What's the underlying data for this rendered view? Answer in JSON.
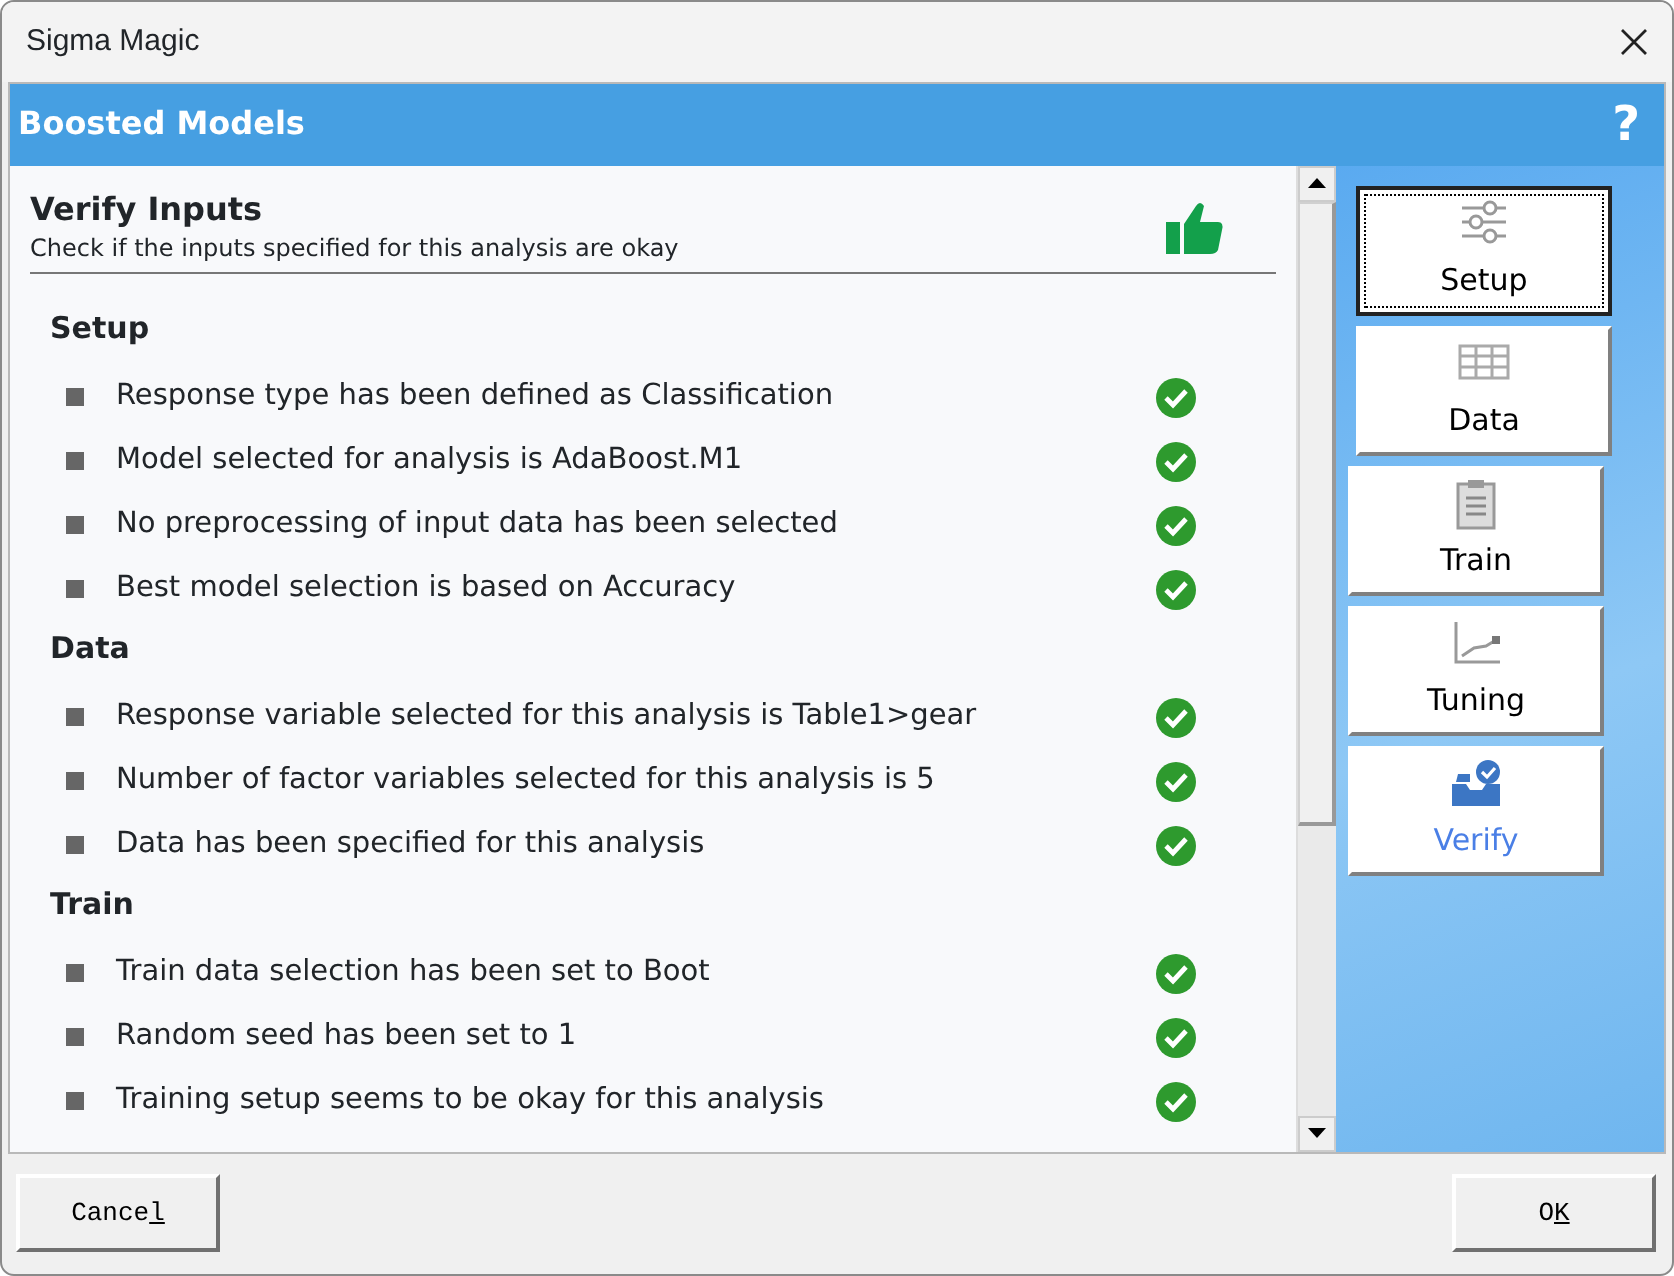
{
  "window": {
    "title": "Sigma Magic"
  },
  "header": {
    "title": "Boosted Models",
    "help": "?"
  },
  "panel": {
    "title": "Verify Inputs",
    "subtitle": "Check if the inputs specified for this analysis are okay"
  },
  "sections": [
    {
      "title": "Setup",
      "items": [
        {
          "text": "Response type has been defined as Classification",
          "ok": true
        },
        {
          "text": "Model selected for analysis is AdaBoost.M1",
          "ok": true
        },
        {
          "text": "No preprocessing of input data has been selected",
          "ok": true
        },
        {
          "text": "Best model selection is based on Accuracy",
          "ok": true
        }
      ]
    },
    {
      "title": "Data",
      "items": [
        {
          "text": "Response variable selected for this analysis is Table1>gear",
          "ok": true
        },
        {
          "text": "Number of factor variables selected for this analysis is 5",
          "ok": true
        },
        {
          "text": "Data has been specified for this analysis",
          "ok": true
        }
      ]
    },
    {
      "title": "Train",
      "items": [
        {
          "text": "Train data selection has been set to Boot",
          "ok": true
        },
        {
          "text": "Random seed has been set to 1",
          "ok": true
        },
        {
          "text": "Training setup seems to be okay for this analysis",
          "ok": true
        }
      ]
    }
  ],
  "nav": [
    {
      "label": "Setup",
      "kind": "setup",
      "selected": false,
      "focused": true
    },
    {
      "label": "Data",
      "kind": "data",
      "selected": false,
      "focused": false
    },
    {
      "label": "Train",
      "kind": "train",
      "selected": false,
      "focused": false
    },
    {
      "label": "Tuning",
      "kind": "tuning",
      "selected": false,
      "focused": false
    },
    {
      "label": "Verify",
      "kind": "verify",
      "selected": true,
      "focused": false
    }
  ],
  "buttons": [
    {
      "label": "Cance",
      "mnemonic": "l"
    },
    {
      "label": "O",
      "mnemonic": "K"
    }
  ]
}
